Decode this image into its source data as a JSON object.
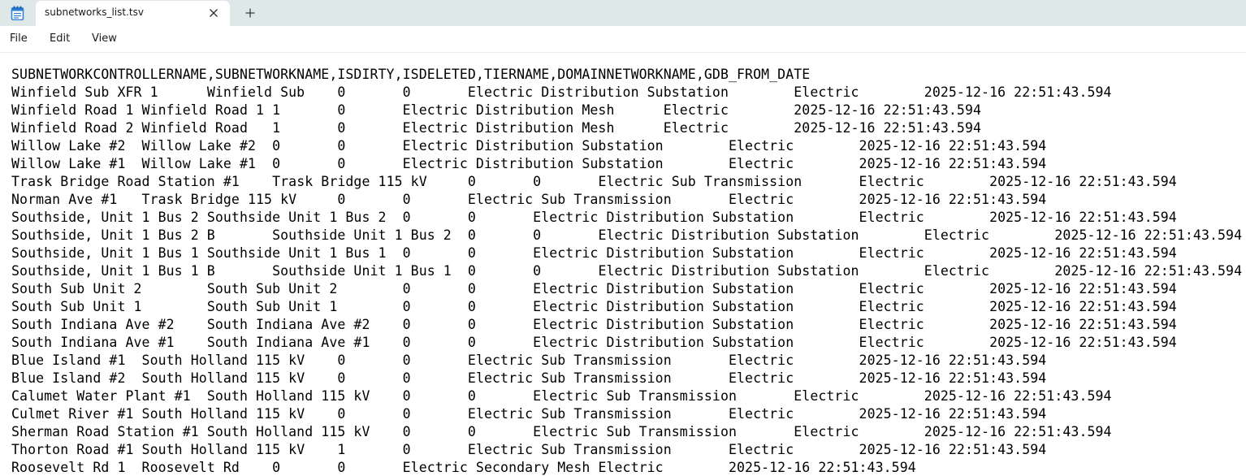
{
  "tab": {
    "title": "subnetworks_list.tsv"
  },
  "menu": {
    "file": "File",
    "edit": "Edit",
    "view": "View"
  },
  "icons": {
    "app": "notepad-icon",
    "close": "close-icon",
    "new_tab": "plus-icon"
  },
  "editor": {
    "content": "SUBNETWORKCONTROLLERNAME,SUBNETWORKNAME,ISDIRTY,ISDELETED,TIERNAME,DOMAINNETWORKNAME,GDB_FROM_DATE\nWinfield Sub XFR 1\tWinfield Sub\t0\t0\tElectric Distribution Substation\tElectric\t2025-12-16 22:51:43.594\nWinfield Road 1\tWinfield Road 1\t1\t0\tElectric Distribution Mesh\tElectric\t2025-12-16 22:51:43.594\nWinfield Road 2\tWinfield Road\t1\t0\tElectric Distribution Mesh\tElectric\t2025-12-16 22:51:43.594\nWillow Lake #2\tWillow Lake #2\t0\t0\tElectric Distribution Substation\tElectric\t2025-12-16 22:51:43.594\nWillow Lake #1\tWillow Lake #1\t0\t0\tElectric Distribution Substation\tElectric\t2025-12-16 22:51:43.594\nTrask Bridge Road Station #1\tTrask Bridge 115 kV\t0\t0\tElectric Sub Transmission\tElectric\t2025-12-16 22:51:43.594\nNorman Ave #1\tTrask Bridge 115 kV\t0\t0\tElectric Sub Transmission\tElectric\t2025-12-16 22:51:43.594\nSouthside, Unit 1 Bus 2\tSouthside Unit 1 Bus 2\t0\t0\tElectric Distribution Substation\tElectric\t2025-12-16 22:51:43.594\nSouthside, Unit 1 Bus 2 B\tSouthside Unit 1 Bus 2\t0\t0\tElectric Distribution Substation\tElectric\t2025-12-16 22:51:43.594\nSouthside, Unit 1 Bus 1\tSouthside Unit 1 Bus 1\t0\t0\tElectric Distribution Substation\tElectric\t2025-12-16 22:51:43.594\nSouthside, Unit 1 Bus 1 B\tSouthside Unit 1 Bus 1\t0\t0\tElectric Distribution Substation\tElectric\t2025-12-16 22:51:43.594\nSouth Sub Unit 2\tSouth Sub Unit 2\t0\t0\tElectric Distribution Substation\tElectric\t2025-12-16 22:51:43.594\nSouth Sub Unit 1\tSouth Sub Unit 1\t0\t0\tElectric Distribution Substation\tElectric\t2025-12-16 22:51:43.594\nSouth Indiana Ave #2\tSouth Indiana Ave #2\t0\t0\tElectric Distribution Substation\tElectric\t2025-12-16 22:51:43.594\nSouth Indiana Ave #1\tSouth Indiana Ave #1\t0\t0\tElectric Distribution Substation\tElectric\t2025-12-16 22:51:43.594\nBlue Island #1\tSouth Holland 115 kV\t0\t0\tElectric Sub Transmission\tElectric\t2025-12-16 22:51:43.594\nBlue Island #2\tSouth Holland 115 kV\t0\t0\tElectric Sub Transmission\tElectric\t2025-12-16 22:51:43.594\nCalumet Water Plant #1\tSouth Holland 115 kV\t0\t0\tElectric Sub Transmission\tElectric\t2025-12-16 22:51:43.594\nCulmet River #1\tSouth Holland 115 kV\t0\t0\tElectric Sub Transmission\tElectric\t2025-12-16 22:51:43.594\nSherman Road Station #1\tSouth Holland 115 kV\t0\t0\tElectric Sub Transmission\tElectric\t2025-12-16 22:51:43.594\nThorton Road #1\tSouth Holland 115 kV\t1\t0\tElectric Sub Transmission\tElectric\t2025-12-16 22:51:43.594\nRoosevelt Rd 1\tRoosevelt Rd\t0\t0\tElectric Secondary Mesh\tElectric\t2025-12-16 22:51:43.594"
  },
  "colors": {
    "titlebar_bg": "#dfe8e9",
    "icon_blue": "#2a7fd4"
  }
}
